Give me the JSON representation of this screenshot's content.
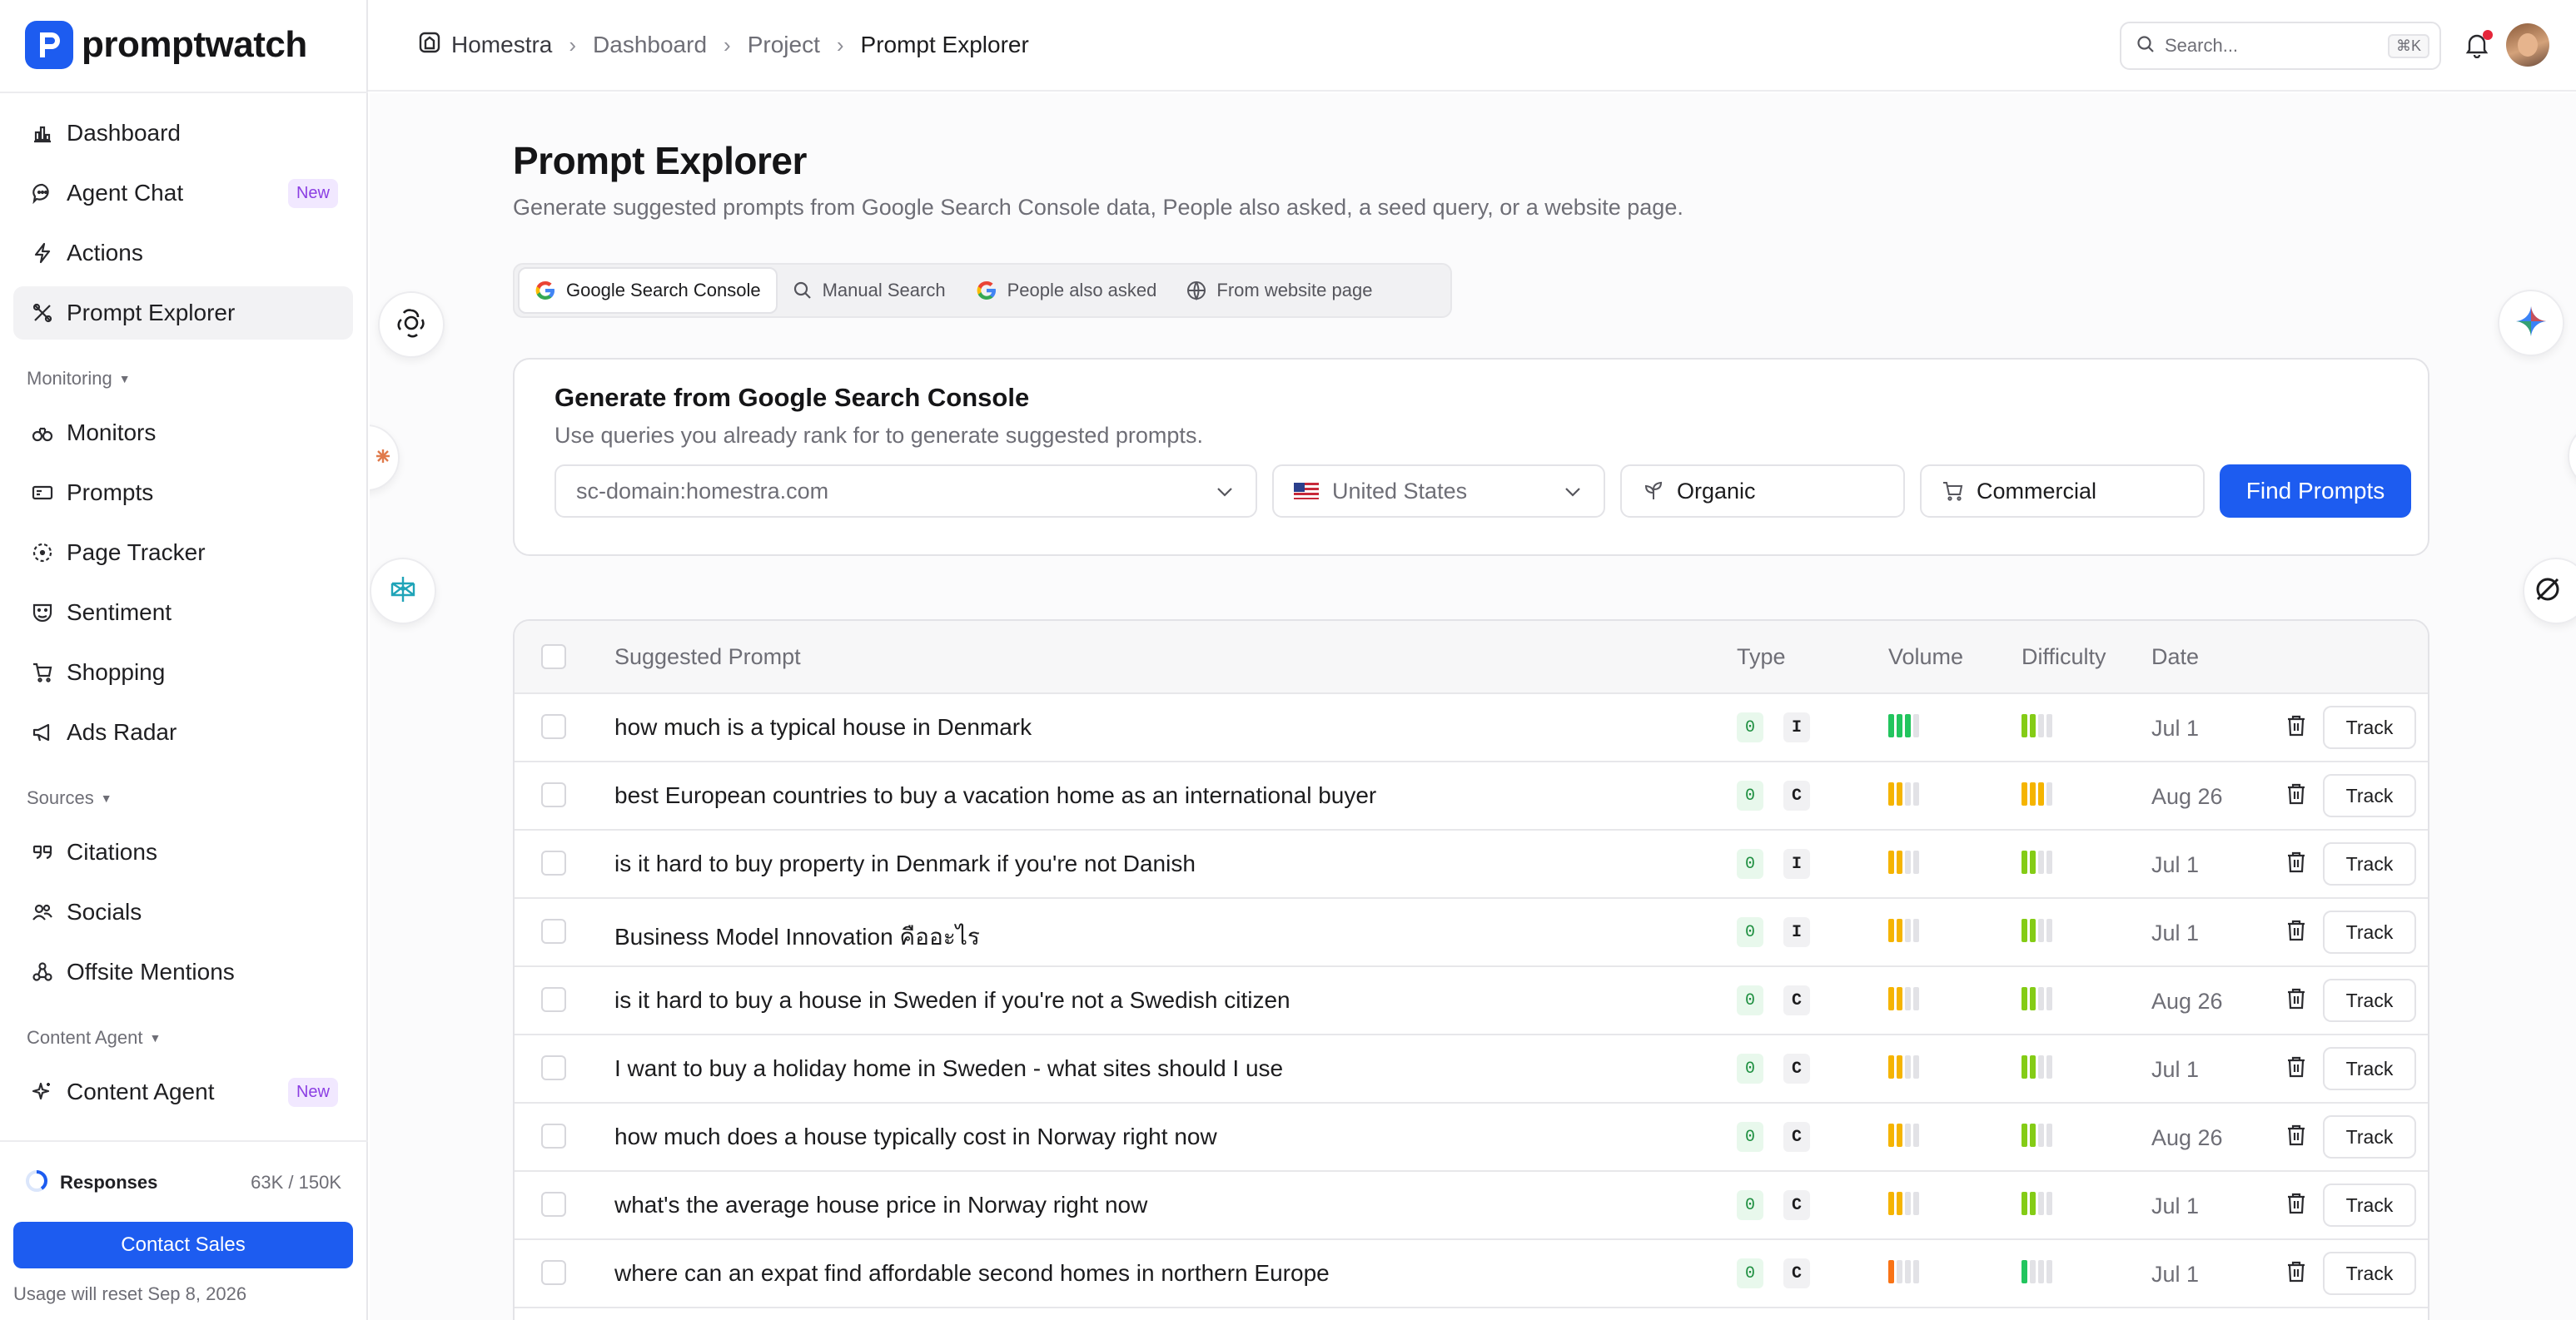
{
  "app": {
    "name": "promptwatch"
  },
  "sidebar": {
    "items": [
      {
        "label": "Dashboard",
        "icon": "bar-chart-icon"
      },
      {
        "label": "Agent Chat",
        "icon": "chat-bubble-icon",
        "badge": "New"
      },
      {
        "label": "Actions",
        "icon": "lightning-icon"
      },
      {
        "label": "Prompt Explorer",
        "icon": "explorer-icon",
        "active": true
      }
    ],
    "sections": [
      {
        "label": "Monitoring",
        "items": [
          {
            "label": "Monitors",
            "icon": "binoculars-icon"
          },
          {
            "label": "Prompts",
            "icon": "prompts-icon"
          },
          {
            "label": "Page Tracker",
            "icon": "page-tracker-icon"
          },
          {
            "label": "Sentiment",
            "icon": "mask-icon"
          },
          {
            "label": "Shopping",
            "icon": "cart-icon"
          },
          {
            "label": "Ads Radar",
            "icon": "megaphone-icon"
          }
        ]
      },
      {
        "label": "Sources",
        "items": [
          {
            "label": "Citations",
            "icon": "quote-icon"
          },
          {
            "label": "Socials",
            "icon": "people-icon"
          },
          {
            "label": "Offsite Mentions",
            "icon": "nodes-icon"
          }
        ]
      },
      {
        "label": "Content Agent",
        "items": [
          {
            "label": "Content Agent",
            "icon": "sparkle-icon",
            "badge": "New"
          }
        ]
      }
    ],
    "responses": {
      "label": "Responses",
      "value": "63K / 150K"
    },
    "contact_sales": "Contact Sales",
    "reset_note": "Usage will reset Sep 8, 2026"
  },
  "header": {
    "breadcrumb": [
      "Homestra",
      "Dashboard",
      "Project",
      "Prompt Explorer"
    ],
    "search_placeholder": "Search...",
    "search_shortcut": "⌘K"
  },
  "main": {
    "title": "Prompt Explorer",
    "subtitle": "Generate suggested prompts from Google Search Console data, People also asked, a seed query, or a website page.",
    "tabs": [
      {
        "label": "Google Search Console",
        "icon": "google-icon",
        "active": true
      },
      {
        "label": "Manual Search",
        "icon": "search-icon"
      },
      {
        "label": "People also asked",
        "icon": "google-icon"
      },
      {
        "label": "From website page",
        "icon": "globe-icon"
      }
    ],
    "gsc": {
      "title": "Generate from Google Search Console",
      "description": "Use queries you already rank for to generate suggested prompts.",
      "domain": "sc-domain:homestra.com",
      "country": "United States",
      "intent_1": "Organic",
      "intent_2": "Commercial",
      "find_button": "Find Prompts"
    },
    "table": {
      "columns": [
        "Suggested Prompt",
        "Type",
        "Volume",
        "Difficulty",
        "Date"
      ],
      "track_label": "Track",
      "rows": [
        {
          "prompt": "how much is a typical house in Denmark",
          "count": "0",
          "type": "I",
          "volume": 3,
          "volume_color": "#22c55e",
          "difficulty": 2,
          "difficulty_color": "#84cc16",
          "date": "Jul 1"
        },
        {
          "prompt": "best European countries to buy a vacation home as an international buyer",
          "count": "0",
          "type": "C",
          "volume": 2,
          "volume_color": "#f5b400",
          "difficulty": 3,
          "difficulty_color": "#f5b400",
          "date": "Aug 26"
        },
        {
          "prompt": "is it hard to buy property in Denmark if you're not Danish",
          "count": "0",
          "type": "I",
          "volume": 2,
          "volume_color": "#f5b400",
          "difficulty": 2,
          "difficulty_color": "#84cc16",
          "date": "Jul 1"
        },
        {
          "prompt": "Business Model Innovation คืออะไร",
          "count": "0",
          "type": "I",
          "volume": 2,
          "volume_color": "#f5b400",
          "difficulty": 2,
          "difficulty_color": "#84cc16",
          "date": "Jul 1"
        },
        {
          "prompt": "is it hard to buy a house in Sweden if you're not a Swedish citizen",
          "count": "0",
          "type": "C",
          "volume": 2,
          "volume_color": "#f5b400",
          "difficulty": 2,
          "difficulty_color": "#84cc16",
          "date": "Aug 26"
        },
        {
          "prompt": "I want to buy a holiday home in Sweden - what sites should I use",
          "count": "0",
          "type": "C",
          "volume": 2,
          "volume_color": "#f5b400",
          "difficulty": 2,
          "difficulty_color": "#84cc16",
          "date": "Jul 1"
        },
        {
          "prompt": "how much does a house typically cost in Norway right now",
          "count": "0",
          "type": "C",
          "volume": 2,
          "volume_color": "#f5b400",
          "difficulty": 2,
          "difficulty_color": "#84cc16",
          "date": "Aug 26"
        },
        {
          "prompt": "what's the average house price in Norway right now",
          "count": "0",
          "type": "C",
          "volume": 2,
          "volume_color": "#f5b400",
          "difficulty": 2,
          "difficulty_color": "#84cc16",
          "date": "Jul 1"
        },
        {
          "prompt": "where can an expat find affordable second homes in northern Europe",
          "count": "0",
          "type": "C",
          "volume": 1,
          "volume_color": "#f97316",
          "difficulty": 1,
          "difficulty_color": "#22c55e",
          "date": "Jul 1"
        }
      ]
    }
  }
}
